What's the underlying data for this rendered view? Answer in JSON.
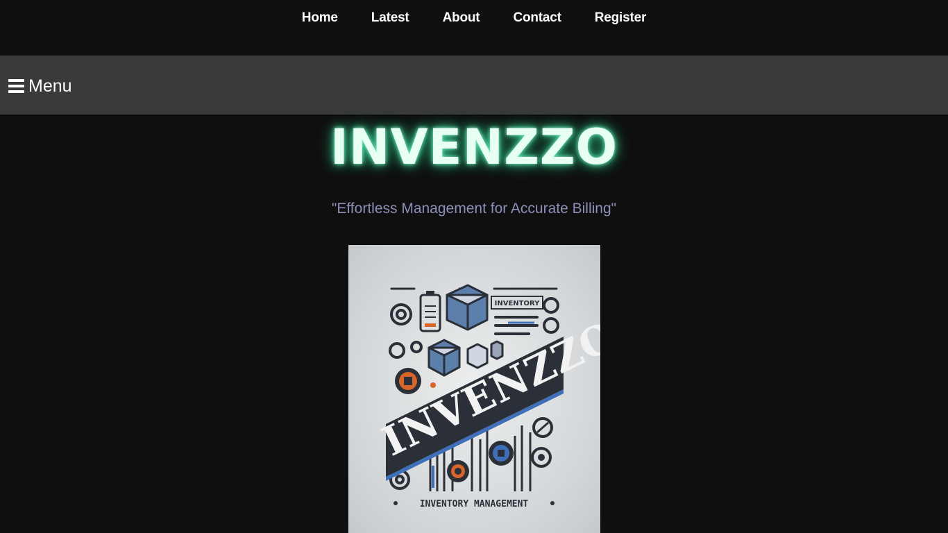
{
  "nav": {
    "items": [
      {
        "label": "Home"
      },
      {
        "label": "Latest"
      },
      {
        "label": "About"
      },
      {
        "label": "Contact"
      },
      {
        "label": "Register"
      }
    ]
  },
  "menubar": {
    "label": "Menu",
    "icon": "hamburger-icon"
  },
  "hero": {
    "title": "INVENZZO",
    "tagline": "\"Effortless Management for Accurate Billing\""
  },
  "logo": {
    "wordmark": "INVENZZO",
    "badge": "INVENTORY",
    "caption": "INVENTORY MANAGEMENT",
    "colors": {
      "dark": "#2b3038",
      "blue": "#3f6fb8",
      "orange": "#d8652a",
      "glow": "#3bd49a"
    }
  }
}
